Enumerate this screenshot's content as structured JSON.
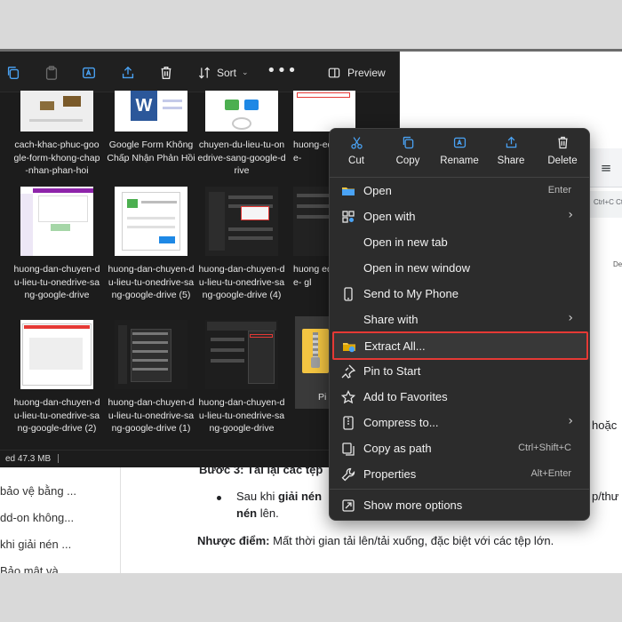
{
  "document": {
    "sidebar_items": [
      "bảo vệ bằng ...",
      "dd-on không...",
      "khi giải nén ...",
      "Bảo mật và ..."
    ],
    "ruler_hint": "Ctrl+C Ctrl",
    "step_heading": "Bước 3: Tải lại các tệp",
    "bullet_prefix": "Sau khi ",
    "bullet_bold": "giải nén",
    "bullet_middle_bold": "nén",
    "bullet_suffix": " lên.",
    "right_fragment_1": "p/thư",
    "right_fragment_2": "hoặc",
    "cons_label": "Nhược điểm:",
    "cons_text": " Mất thời gian tải lên/tải xuống, đặc biệt với các tệp lớn.",
    "side_text": "De"
  },
  "explorer": {
    "toolbar": {
      "sort_label": "Sort",
      "preview_label": "Preview",
      "more_label": "•••"
    },
    "items": [
      {
        "label": "cach-khac-phuc-google-form-khong-chap-nhan-phan-hoi"
      },
      {
        "label": "Google Form Không Chấp Nhận Phản Hồi"
      },
      {
        "label": "chuyen-du-lieu-tu-onedrive-sang-google-drive"
      },
      {
        "label": "huong-edrive-"
      },
      {
        "label": "huong-dan-chuyen-du-lieu-tu-onedrive-sang-google-drive"
      },
      {
        "label": "huong-dan-chuyen-du-lieu-tu-onedrive-sang-google-drive (5)"
      },
      {
        "label": "huong-dan-chuyen-du-lieu-tu-onedrive-sang-google-drive (4)"
      },
      {
        "label": "huong edrive- gl"
      },
      {
        "label": "huong-dan-chuyen-du-lieu-tu-onedrive-sang-google-drive (2)"
      },
      {
        "label": "huong-dan-chuyen-du-lieu-tu-onedrive-sang-google-drive (1)"
      },
      {
        "label": "huong-dan-chuyen-du-lieu-tu-onedrive-sang-google-drive"
      },
      {
        "label": "Pi"
      }
    ],
    "status": {
      "text": "ed  47.3 MB"
    }
  },
  "context_menu": {
    "quick_actions": [
      {
        "label": "Cut",
        "icon": "scissors-icon"
      },
      {
        "label": "Copy",
        "icon": "copy-icon"
      },
      {
        "label": "Rename",
        "icon": "rename-icon"
      },
      {
        "label": "Share",
        "icon": "share-icon"
      },
      {
        "label": "Delete",
        "icon": "trash-icon"
      }
    ],
    "items": [
      {
        "label": "Open",
        "shortcut": "Enter"
      },
      {
        "label": "Open with",
        "shortcut": ""
      },
      {
        "label": "Open in new tab",
        "shortcut": ""
      },
      {
        "label": "Open in new window",
        "shortcut": ""
      },
      {
        "label": "Send to My Phone",
        "shortcut": ""
      },
      {
        "label": "Share with",
        "shortcut": ""
      },
      {
        "label": "Extract All...",
        "shortcut": ""
      },
      {
        "label": "Pin to Start",
        "shortcut": ""
      },
      {
        "label": "Add to Favorites",
        "shortcut": ""
      },
      {
        "label": "Compress to...",
        "shortcut": ""
      },
      {
        "label": "Copy as path",
        "shortcut": "Ctrl+Shift+C"
      },
      {
        "label": "Properties",
        "shortcut": "Alt+Enter"
      },
      {
        "label": "Show more options",
        "shortcut": ""
      }
    ],
    "submenu_arrow": "›"
  },
  "colors": {
    "highlight_border": "#e53935",
    "menu_bg": "#2c2c2c",
    "explorer_bg": "#1c1c1c",
    "accent_blue": "#4aa3f5",
    "folder_yellow": "#f4c542"
  }
}
